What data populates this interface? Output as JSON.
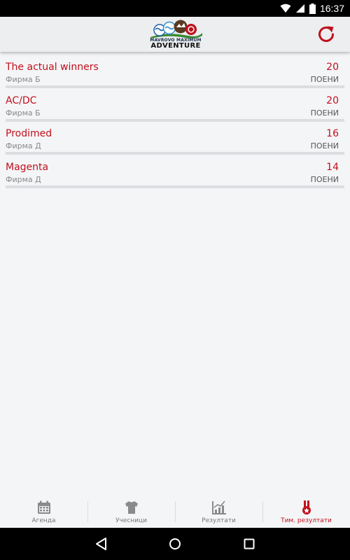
{
  "status_bar": {
    "time": "16:37"
  },
  "header": {
    "logo_line1": "MAVROVO MAXIMUM",
    "logo_line2": "ADVENTURE",
    "refresh_icon": "refresh-icon"
  },
  "colors": {
    "accent": "#c0101c",
    "divider": "#dcdde0",
    "background": "#f4f5f7"
  },
  "results": [
    {
      "team": "The actual winners",
      "company": "Фирма Б",
      "points": "20",
      "points_label": "ПОЕНИ"
    },
    {
      "team": "AC/DC",
      "company": "Фирма Б",
      "points": "20",
      "points_label": "ПОЕНИ"
    },
    {
      "team": "Prodimed",
      "company": "Фирма Д",
      "points": "16",
      "points_label": "ПОЕНИ"
    },
    {
      "team": "Magenta",
      "company": "Фирма Д",
      "points": "14",
      "points_label": "ПОЕНИ"
    }
  ],
  "bottom_nav": [
    {
      "label": "Агенда",
      "icon": "calendar-icon",
      "active": false
    },
    {
      "label": "Учесници",
      "icon": "tshirt-icon",
      "active": false
    },
    {
      "label": "Резултати",
      "icon": "chart-icon",
      "active": false
    },
    {
      "label": "Тим. резултати",
      "icon": "medal-icon",
      "active": true
    }
  ]
}
